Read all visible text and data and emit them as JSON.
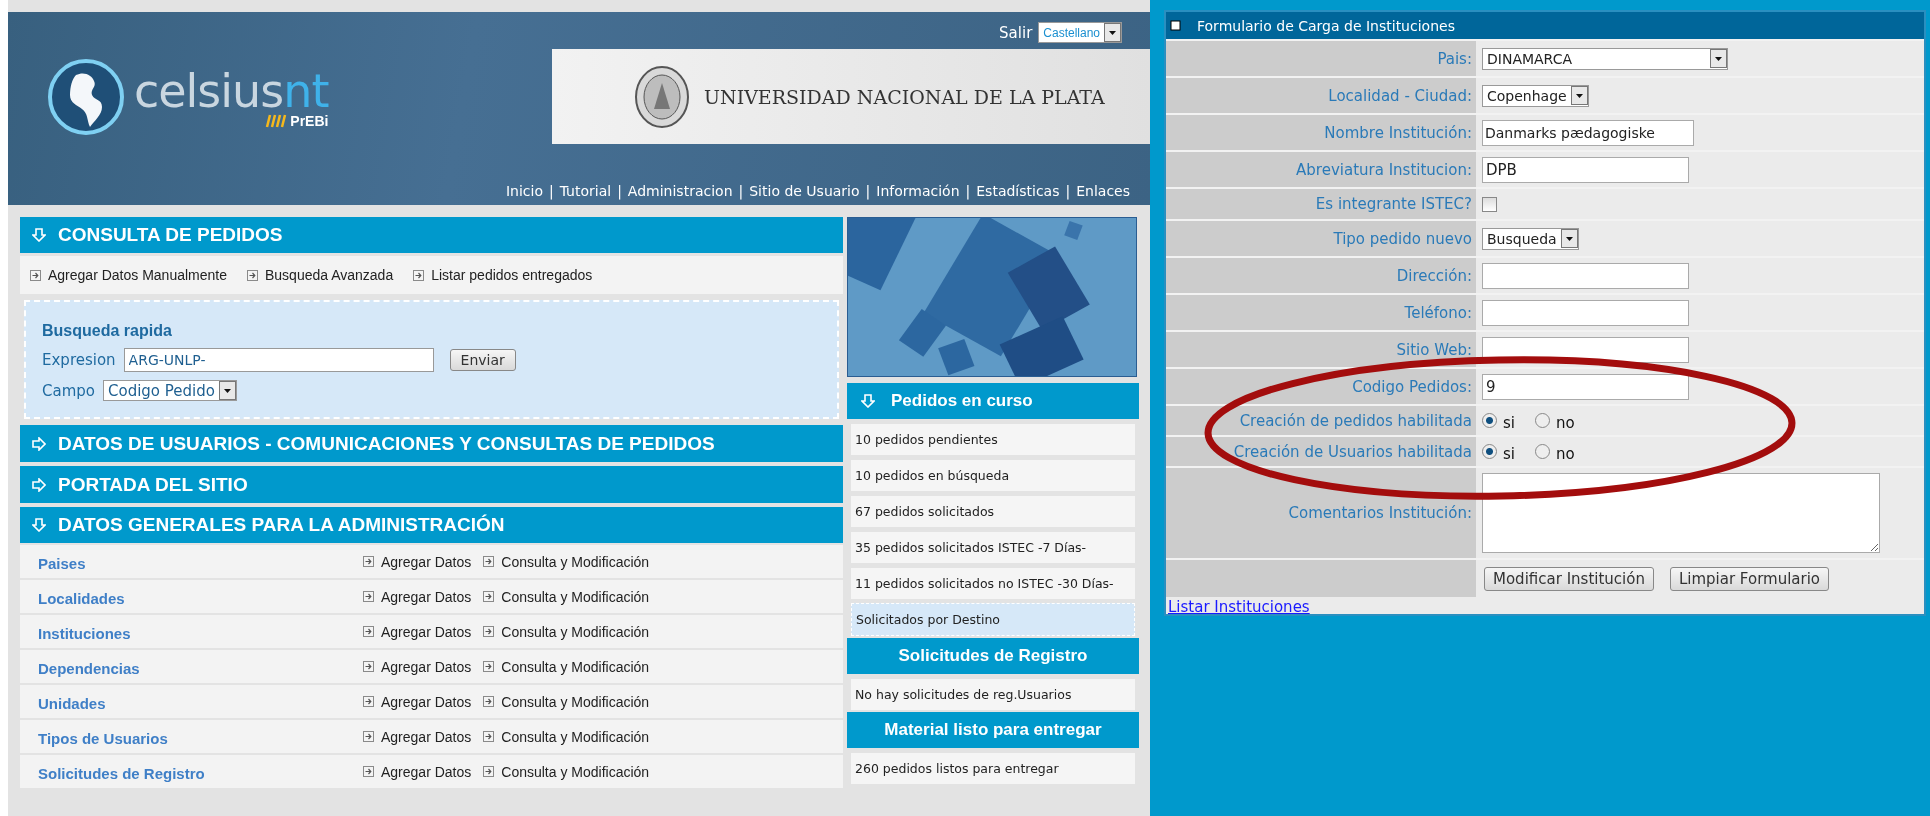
{
  "header": {
    "brand": "celsius",
    "brand_accent": "nt",
    "sub_brand": "PrEBi",
    "logout": "Salir",
    "language": "Castellano",
    "university": "UNIVERSIDAD NACIONAL DE LA PLATA",
    "nav_separator": "|",
    "nav": [
      "Inicio",
      "Tutorial",
      "Administracion",
      "Sitio de Usuario",
      "Información",
      "Estadísticas",
      "Enlaces"
    ]
  },
  "sections": [
    {
      "kind": "consulta",
      "title": "CONSULTA DE PEDIDOS",
      "expanded": true,
      "links": [
        "Agregar Datos Manualmente",
        "Busqueda Avanzada",
        "Listar pedidos entregados"
      ],
      "quick_search": {
        "title": "Busqueda rapida",
        "expression_label": "Expresion",
        "expression_value": "ARG-UNLP-",
        "submit": "Enviar",
        "field_label": "Campo",
        "field_value": "Codigo Pedido"
      }
    },
    {
      "kind": "plain",
      "title": "DATOS DE USUARIOS - COMUNICACIONES Y CONSULTAS DE PEDIDOS",
      "expanded": false
    },
    {
      "kind": "plain",
      "title": "PORTADA DEL SITIO",
      "expanded": false
    },
    {
      "kind": "admin",
      "title": "DATOS GENERALES PARA LA ADMINISTRACIÓN",
      "expanded": true,
      "rows": [
        {
          "name": "Paises",
          "actions": [
            "Agregar Datos",
            "Consulta y Modificación"
          ]
        },
        {
          "name": "Localidades",
          "actions": [
            "Agregar Datos",
            "Consulta y Modificación"
          ]
        },
        {
          "name": "Instituciones",
          "actions": [
            "Agregar Datos",
            "Consulta y Modificación"
          ]
        },
        {
          "name": "Dependencias",
          "actions": [
            "Agregar Datos",
            "Consulta y Modificación"
          ]
        },
        {
          "name": "Unidades",
          "actions": [
            "Agregar Datos",
            "Consulta y Modificación"
          ]
        },
        {
          "name": "Tipos de Usuarios",
          "actions": [
            "Agregar Datos",
            "Consulta y Modificación"
          ]
        },
        {
          "name": "Solicitudes de Registro",
          "actions": [
            "Agregar Datos",
            "Consulta y Modificación"
          ]
        }
      ]
    }
  ],
  "sidebar": {
    "panels": [
      {
        "title": "Pedidos en curso",
        "expanded": true,
        "items": [
          {
            "text": "10 pedidos pendientes",
            "highlighted": false
          },
          {
            "text": "10 pedidos en búsqueda",
            "highlighted": false
          },
          {
            "text": "67 pedidos solicitados",
            "highlighted": false
          },
          {
            "text": "35 pedidos solicitados ISTEC -7 Días-",
            "highlighted": false
          },
          {
            "text": "11 pedidos solicitados no ISTEC -30 Días-",
            "highlighted": false
          },
          {
            "text": "Solicitados por Destino",
            "highlighted": true
          }
        ]
      },
      {
        "title": "Solicitudes de Registro",
        "items": [
          {
            "text": "No hay solicitudes de reg.Usuarios",
            "highlighted": false
          }
        ]
      },
      {
        "title": "Material listo para entregar",
        "items": [
          {
            "text": "260 pedidos listos para entregar",
            "highlighted": false
          }
        ]
      }
    ]
  },
  "form": {
    "title": "Formulario de Carga de Instituciones",
    "rows": [
      {
        "kind": "select",
        "label": "Pais:",
        "value": "DINAMARCA"
      },
      {
        "kind": "select",
        "label": "Localidad - Ciudad:",
        "value": "Copenhage"
      },
      {
        "kind": "text",
        "label": "Nombre Institución:",
        "value": "Danmarks pædagogiske"
      },
      {
        "kind": "text",
        "label": "Abreviatura Institucion:",
        "value": "DPB"
      },
      {
        "kind": "checkbox",
        "label": "Es integrante ISTEC?",
        "checked": false
      },
      {
        "kind": "select",
        "label": "Tipo pedido nuevo",
        "value": "Busqueda"
      },
      {
        "kind": "text",
        "label": "Dirección:"
      },
      {
        "kind": "text",
        "label": "Teléfono:"
      },
      {
        "kind": "text",
        "label": "Sitio Web:"
      },
      {
        "kind": "text",
        "label": "Codigo Pedidos:",
        "value": "9"
      },
      {
        "kind": "radio",
        "label": "Creación de pedidos habilitada",
        "options": [
          {
            "label": "si",
            "selected": true
          },
          {
            "label": "no",
            "selected": false
          }
        ]
      },
      {
        "kind": "radio",
        "label": "Creación de Usuarios habilitada",
        "options": [
          {
            "label": "si",
            "selected": true
          },
          {
            "label": "no",
            "selected": false
          }
        ]
      },
      {
        "kind": "textarea",
        "label": "Comentarios Institución:"
      },
      {
        "kind": "buttons",
        "buttons": [
          "Modificar Institución",
          "Limpiar Formulario"
        ]
      }
    ],
    "link": "Listar Instituciones"
  }
}
